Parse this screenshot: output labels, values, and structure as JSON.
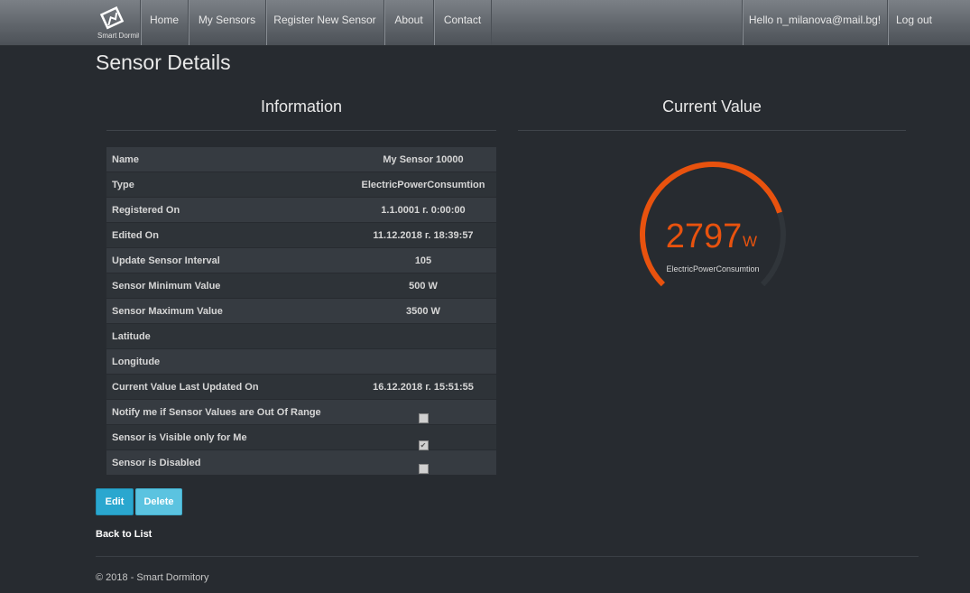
{
  "nav": {
    "brand_text": "Smart Dormitory",
    "items": [
      "Home",
      "My Sensors",
      "Register New Sensor",
      "About",
      "Contact"
    ],
    "greeting": "Hello n_milanova@mail.bg!",
    "logout": "Log out"
  },
  "page": {
    "title": "Sensor Details",
    "information_heading": "Information",
    "current_value_heading": "Current Value"
  },
  "details": [
    {
      "label": "Name",
      "value": "My Sensor 10000"
    },
    {
      "label": "Type",
      "value": "ElectricPowerConsumtion"
    },
    {
      "label": "Registered On",
      "value": "1.1.0001 г. 0:00:00"
    },
    {
      "label": "Edited On",
      "value": "11.12.2018 г. 18:39:57"
    },
    {
      "label": "Update Sensor Interval",
      "value": "105"
    },
    {
      "label": "Sensor Minimum Value",
      "value": "500 W"
    },
    {
      "label": "Sensor Maximum Value",
      "value": "3500 W"
    },
    {
      "label": "Latitude",
      "value": ""
    },
    {
      "label": "Longitude",
      "value": ""
    },
    {
      "label": "Current Value Last Updated On",
      "value": "16.12.2018 г. 15:51:55"
    }
  ],
  "flags": [
    {
      "label": "Notify me if Sensor Values are Out Of Range",
      "checked": false
    },
    {
      "label": "Sensor is Visible only for Me",
      "checked": true
    },
    {
      "label": "Sensor is Disabled",
      "checked": false
    }
  ],
  "gauge": {
    "value": "2797",
    "unit": "W",
    "type_label": "ElectricPowerConsumtion",
    "min": 500,
    "max": 3500,
    "current": 2797,
    "color": "#e8520e",
    "track_color": "#30353a"
  },
  "actions": {
    "edit": "Edit",
    "delete": "Delete",
    "back": "Back to List"
  },
  "footer": "© 2018 - Smart Dormitory"
}
